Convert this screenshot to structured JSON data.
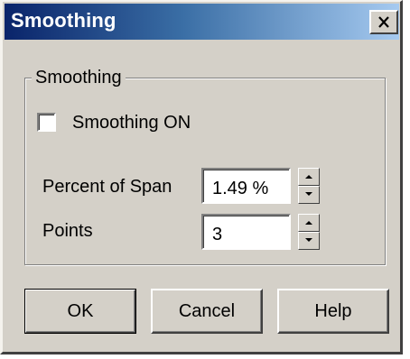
{
  "window": {
    "title": "Smoothing",
    "close_icon": "close-icon"
  },
  "group": {
    "legend": "Smoothing"
  },
  "checkbox": {
    "label": "Smoothing ON",
    "checked": false
  },
  "fields": {
    "percent_of_span": {
      "label": "Percent of Span",
      "value": "1.49 %"
    },
    "points": {
      "label": "Points",
      "value": "3"
    }
  },
  "buttons": {
    "ok": "OK",
    "cancel": "Cancel",
    "help": "Help"
  },
  "colors": {
    "face": "#d4d0c8",
    "title_start": "#0a246a",
    "title_end": "#a6caf0"
  }
}
